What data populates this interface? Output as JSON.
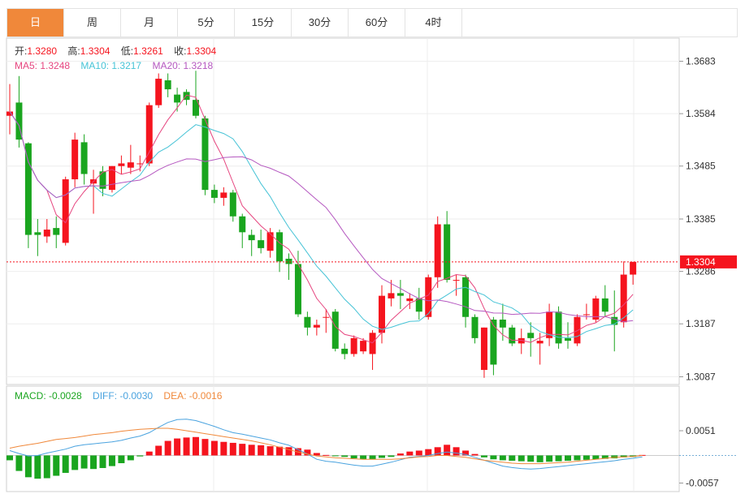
{
  "tabs": [
    {
      "label": "日",
      "active": true
    },
    {
      "label": "周",
      "active": false
    },
    {
      "label": "月",
      "active": false
    },
    {
      "label": "5分",
      "active": false
    },
    {
      "label": "15分",
      "active": false
    },
    {
      "label": "30分",
      "active": false
    },
    {
      "label": "60分",
      "active": false
    },
    {
      "label": "4时",
      "active": false
    }
  ],
  "ohlc": {
    "open_label": "开:",
    "open": "1.3280",
    "high_label": "高:",
    "high": "1.3304",
    "low_label": "低:",
    "low": "1.3261",
    "close_label": "收:",
    "close": "1.3304"
  },
  "ma": {
    "ma5_label": "MA5: ",
    "ma5": "1.3248",
    "ma10_label": "MA10: ",
    "ma10": "1.3217",
    "ma20_label": "MA20: ",
    "ma20": "1.3218"
  },
  "macd": {
    "macd_label": "MACD: ",
    "macd": "-0.0028",
    "diff_label": "DIFF: ",
    "diff": "-0.0030",
    "dea_label": "DEA: ",
    "dea": "-0.0016"
  },
  "colors": {
    "up": "#f5141e",
    "down": "#1aa51f",
    "ma5": "#e6457f",
    "ma10": "#46c3d6",
    "ma20": "#b558c0",
    "diff": "#4aa3df",
    "dea": "#f0883a",
    "accent": "#f0883a"
  },
  "chart_data": [
    {
      "type": "candlestick",
      "title": "",
      "price_ticks": [
        "1.3683",
        "1.3584",
        "1.3485",
        "1.3385",
        "1.3286",
        "1.3187",
        "1.3087"
      ],
      "last_price": "1.3304",
      "ylim": [
        1.3075,
        1.372
      ],
      "grid": true,
      "candles": [
        [
          1.358,
          1.364,
          1.3545,
          1.3588
        ],
        [
          1.3605,
          1.3655,
          1.352,
          1.3535
        ],
        [
          1.3528,
          1.353,
          1.333,
          1.3355
        ],
        [
          1.336,
          1.3385,
          1.3315,
          1.3355
        ],
        [
          1.3352,
          1.3385,
          1.334,
          1.3365
        ],
        [
          1.3368,
          1.339,
          1.333,
          1.3355
        ],
        [
          1.334,
          1.3465,
          1.3335,
          1.346
        ],
        [
          1.346,
          1.3548,
          1.3445,
          1.3535
        ],
        [
          1.353,
          1.3545,
          1.345,
          1.347
        ],
        [
          1.3452,
          1.3478,
          1.3395,
          1.346
        ],
        [
          1.3475,
          1.3485,
          1.3428,
          1.3442
        ],
        [
          1.344,
          1.3485,
          1.3435,
          1.3485
        ],
        [
          1.3485,
          1.3505,
          1.347,
          1.349
        ],
        [
          1.3482,
          1.3525,
          1.347,
          1.3492
        ],
        [
          1.349,
          1.3505,
          1.3475,
          1.349
        ],
        [
          1.349,
          1.3605,
          1.3485,
          1.36
        ],
        [
          1.36,
          1.366,
          1.3595,
          1.365
        ],
        [
          1.3647,
          1.366,
          1.3615,
          1.363
        ],
        [
          1.362,
          1.3633,
          1.3588,
          1.3605
        ],
        [
          1.3625,
          1.363,
          1.36,
          1.361
        ],
        [
          1.361,
          1.3665,
          1.3575,
          1.358
        ],
        [
          1.3575,
          1.358,
          1.343,
          1.344
        ],
        [
          1.344,
          1.345,
          1.3415,
          1.3425
        ],
        [
          1.3425,
          1.3445,
          1.341,
          1.3435
        ],
        [
          1.3435,
          1.344,
          1.338,
          1.339
        ],
        [
          1.339,
          1.3395,
          1.333,
          1.336
        ],
        [
          1.3355,
          1.3365,
          1.3315,
          1.3345
        ],
        [
          1.3345,
          1.3365,
          1.332,
          1.333
        ],
        [
          1.3325,
          1.3368,
          1.3312,
          1.336
        ],
        [
          1.336,
          1.3365,
          1.3285,
          1.3305
        ],
        [
          1.331,
          1.332,
          1.327,
          1.33
        ],
        [
          1.33,
          1.3325,
          1.32,
          1.3205
        ],
        [
          1.32,
          1.321,
          1.3165,
          1.318
        ],
        [
          1.318,
          1.3195,
          1.3165,
          1.3185
        ],
        [
          1.32,
          1.3215,
          1.317,
          1.32
        ],
        [
          1.321,
          1.3215,
          1.3135,
          1.314
        ],
        [
          1.314,
          1.315,
          1.312,
          1.313
        ],
        [
          1.313,
          1.3165,
          1.3125,
          1.316
        ],
        [
          1.3135,
          1.316,
          1.313,
          1.3155
        ],
        [
          1.313,
          1.3175,
          1.31,
          1.317
        ],
        [
          1.317,
          1.326,
          1.315,
          1.324
        ],
        [
          1.3235,
          1.327,
          1.322,
          1.3245
        ],
        [
          1.3245,
          1.327,
          1.3215,
          1.324
        ],
        [
          1.323,
          1.3245,
          1.3215,
          1.3235
        ],
        [
          1.3235,
          1.3255,
          1.3195,
          1.321
        ],
        [
          1.32,
          1.328,
          1.3195,
          1.3275
        ],
        [
          1.3275,
          1.339,
          1.3255,
          1.3375
        ],
        [
          1.3375,
          1.34,
          1.3265,
          1.327
        ],
        [
          1.327,
          1.328,
          1.324,
          1.327
        ],
        [
          1.3275,
          1.328,
          1.318,
          1.32
        ],
        [
          1.32,
          1.3205,
          1.315,
          1.316
        ],
        [
          1.31,
          1.318,
          1.3085,
          1.318
        ],
        [
          1.3195,
          1.32,
          1.309,
          1.311
        ],
        [
          1.3195,
          1.3225,
          1.3155,
          1.318
        ],
        [
          1.318,
          1.3185,
          1.3145,
          1.315
        ],
        [
          1.315,
          1.3178,
          1.313,
          1.316
        ],
        [
          1.317,
          1.319,
          1.3125,
          1.316
        ],
        [
          1.315,
          1.317,
          1.311,
          1.3155
        ],
        [
          1.316,
          1.3225,
          1.3145,
          1.321
        ],
        [
          1.321,
          1.322,
          1.314,
          1.315
        ],
        [
          1.316,
          1.319,
          1.314,
          1.3155
        ],
        [
          1.315,
          1.3205,
          1.3145,
          1.32
        ],
        [
          1.3205,
          1.3225,
          1.3195,
          1.3205
        ],
        [
          1.3195,
          1.324,
          1.319,
          1.3235
        ],
        [
          1.3235,
          1.326,
          1.32,
          1.321
        ],
        [
          1.32,
          1.325,
          1.3135,
          1.3185
        ],
        [
          1.319,
          1.3305,
          1.318,
          1.328
        ],
        [
          1.328,
          1.3304,
          1.3261,
          1.3304
        ]
      ]
    },
    {
      "type": "bar",
      "title": "",
      "y_ticks": [
        "0.0051",
        "-0.0057"
      ],
      "ylim": [
        -0.0085,
        0.01
      ],
      "macd_hist": [
        -0.001,
        -0.0032,
        -0.0045,
        -0.0048,
        -0.0047,
        -0.0042,
        -0.0036,
        -0.003,
        -0.0027,
        -0.0028,
        -0.0026,
        -0.0022,
        -0.0016,
        -0.001,
        -0.0002,
        0.0008,
        0.002,
        0.003,
        0.0035,
        0.0037,
        0.0038,
        0.0034,
        0.003,
        0.0028,
        0.0026,
        0.0024,
        0.0022,
        0.0021,
        0.0019,
        0.0018,
        0.0017,
        0.0015,
        0.0012,
        0.0005,
        0.0001,
        -0.0001,
        -0.0003,
        -0.0006,
        -0.0008,
        -0.0008,
        -0.0005,
        -0.0003,
        0.0004,
        0.0008,
        0.001,
        0.0013,
        0.0017,
        0.0022,
        0.0017,
        0.001,
        0.0003,
        -0.0004,
        -0.0008,
        -0.001,
        -0.0011,
        -0.0012,
        -0.0013,
        -0.0014,
        -0.0013,
        -0.0012,
        -0.0011,
        -0.001,
        -0.0009,
        -0.0008,
        -0.0007,
        -0.0006,
        -0.0004,
        -0.0003,
        0.0001
      ],
      "diff": [
        0.001,
        0.0004,
        -0.0001,
        0.0,
        0.0005,
        0.0009,
        0.0013,
        0.0019,
        0.0022,
        0.0024,
        0.0026,
        0.0028,
        0.0031,
        0.0036,
        0.004,
        0.0047,
        0.0058,
        0.0068,
        0.0074,
        0.0075,
        0.0072,
        0.0066,
        0.006,
        0.0053,
        0.0047,
        0.0044,
        0.004,
        0.0036,
        0.0032,
        0.0026,
        0.0021,
        0.0012,
        0.0003,
        -0.0008,
        -0.0012,
        -0.0014,
        -0.0017,
        -0.002,
        -0.0022,
        -0.0022,
        -0.0018,
        -0.0014,
        -0.0009,
        -0.0004,
        -0.0002,
        0.0,
        0.0004,
        0.0007,
        0.0005,
        0.0002,
        -0.0004,
        -0.001,
        -0.0016,
        -0.0022,
        -0.0025,
        -0.0027,
        -0.0028,
        -0.0027,
        -0.0025,
        -0.0023,
        -0.0021,
        -0.0019,
        -0.0017,
        -0.0015,
        -0.0013,
        -0.0011,
        -0.0008,
        -0.0006,
        -0.0003
      ],
      "dea": [
        0.0015,
        0.0019,
        0.0022,
        0.0025,
        0.0029,
        0.0033,
        0.0035,
        0.0037,
        0.004,
        0.0043,
        0.0045,
        0.0047,
        0.005,
        0.0052,
        0.0054,
        0.0055,
        0.0056,
        0.0056,
        0.0054,
        0.0051,
        0.0048,
        0.0045,
        0.0042,
        0.0039,
        0.0036,
        0.0033,
        0.003,
        0.0026,
        0.0022,
        0.0017,
        0.0012,
        0.0007,
        0.0003,
        -0.0001,
        -0.0003,
        -0.0005,
        -0.0006,
        -0.0007,
        -0.0008,
        -0.0008,
        -0.0008,
        -0.0008,
        -0.0007,
        -0.0005,
        -0.0003,
        -0.0002,
        0.0,
        0.0,
        -0.0002,
        -0.0004,
        -0.0007,
        -0.001,
        -0.0012,
        -0.0014,
        -0.0016,
        -0.0017,
        -0.0017,
        -0.0017,
        -0.0016,
        -0.0015,
        -0.0014,
        -0.0012,
        -0.001,
        -0.0008,
        -0.0006,
        -0.0004,
        -0.0003,
        -0.0002,
        0.0
      ]
    }
  ]
}
